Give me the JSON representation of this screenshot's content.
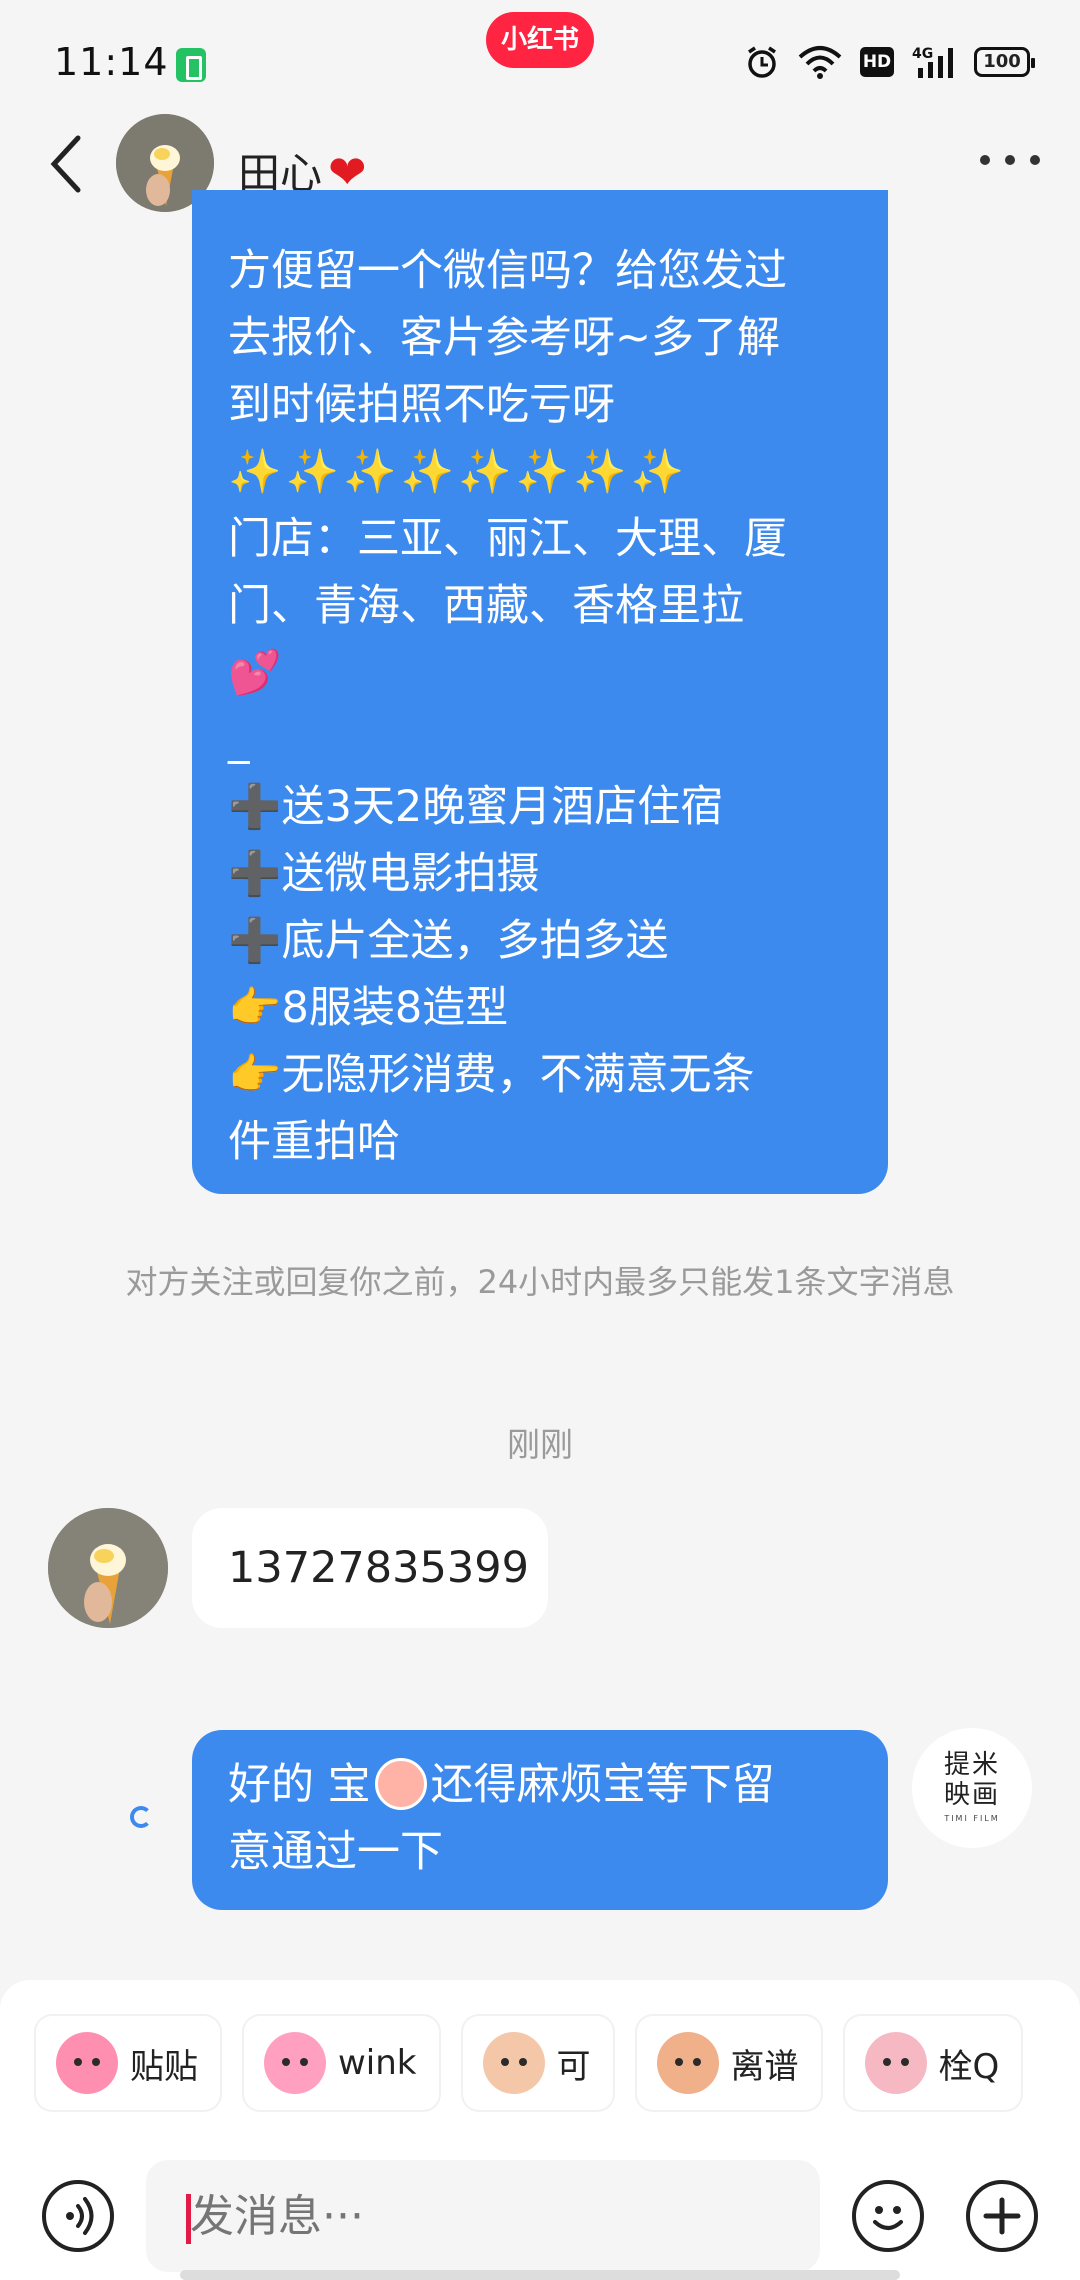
{
  "status_bar": {
    "time": "11:14",
    "app_badge": "小红书",
    "hd": "HD",
    "network": "4G",
    "battery": "100"
  },
  "header": {
    "contact_name": "田心",
    "name_emoji": "❤"
  },
  "messages": {
    "promo": {
      "lines": [
        "方便留一个微信吗？给您发过",
        "去报价、客片参考呀~多了解",
        "到时候拍照不吃亏呀",
        "✨✨✨✨✨✨✨✨",
        "门店：三亚、丽江、大理、厦",
        "门、青海、西藏、香格里拉",
        "💕",
        "_",
        "送3天2晚蜜月酒店住宿",
        "送微电影拍摄",
        "底片全送，多拍多送",
        "8服装8造型",
        "无隐形消费，不满意无条",
        "件重拍哈"
      ],
      "plus_icon": "➕",
      "hand_icon": "👉"
    },
    "notice": "对方关注或回复你之前，24小时内最多只能发1条文字消息",
    "timestamp": "刚刚",
    "incoming_phone": "13727835399",
    "reply_part1": "好的 宝",
    "reply_part2": "还得麻烦宝等下留",
    "reply_line2": "意通过一下",
    "my_avatar_text_1": "提米",
    "my_avatar_text_2": "映画",
    "my_avatar_text_en": "TIMI FILM"
  },
  "stickers": [
    {
      "label": "贴贴",
      "color": "#ff8fb1"
    },
    {
      "label": "wink",
      "color": "#ffa0c0"
    },
    {
      "label": "可",
      "color": "#f4c7a8"
    },
    {
      "label": "离谱",
      "color": "#f0b08a"
    },
    {
      "label": "栓Q",
      "color": "#f6b9c3"
    }
  ],
  "composer": {
    "placeholder": "发消息···"
  },
  "colors": {
    "outgoing_bubble": "#3d8aef",
    "brand": "#ff2442",
    "background": "#f5f5f5"
  }
}
